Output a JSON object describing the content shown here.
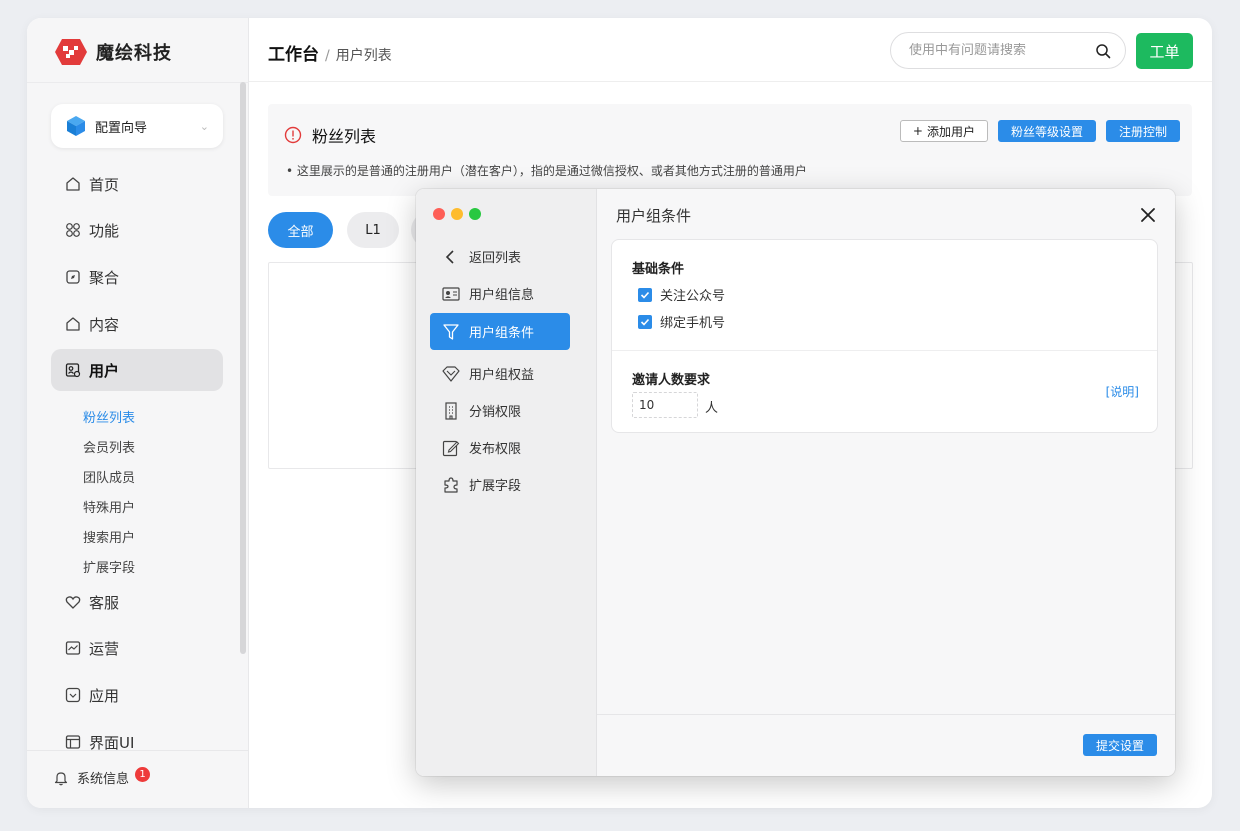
{
  "brand": {
    "name": "魔绘科技"
  },
  "header": {
    "breadcrumb_main": "工作台",
    "breadcrumb_sep": "/",
    "breadcrumb_sub": "用户列表",
    "search_placeholder": "使用中有问题请搜索",
    "ticket_label": "工单"
  },
  "sidebar": {
    "wizard_label": "配置向导",
    "items": [
      {
        "label": "首页",
        "icon": "home-icon"
      },
      {
        "label": "功能",
        "icon": "grid-icon"
      },
      {
        "label": "聚合",
        "icon": "compass-icon"
      },
      {
        "label": "内容",
        "icon": "home-icon"
      },
      {
        "label": "用户",
        "icon": "user-card-icon",
        "active": true
      },
      {
        "label": "客服",
        "icon": "heart-icon"
      },
      {
        "label": "运营",
        "icon": "chart-icon"
      },
      {
        "label": "应用",
        "icon": "app-icon"
      },
      {
        "label": "界面UI",
        "icon": "layout-icon"
      }
    ],
    "sub_items": [
      "粉丝列表",
      "会员列表",
      "团队成员",
      "特殊用户",
      "搜索用户",
      "扩展字段"
    ],
    "system_info_label": "系统信息",
    "system_info_badge": "1"
  },
  "panel": {
    "title": "粉丝列表",
    "add_user_label": "添加用户",
    "level_settings_label": "粉丝等级设置",
    "register_control_label": "注册控制",
    "note": "• 这里展示的是普通的注册用户（潜在客户），指的是通过微信授权、或者其他方式注册的普通用户"
  },
  "filters": {
    "all_label": "全部",
    "l1_label": "L1"
  },
  "modal": {
    "title": "用户组条件",
    "nav": [
      {
        "label": "返回列表",
        "icon": "chevron-left-icon"
      },
      {
        "label": "用户组信息",
        "icon": "id-card-icon"
      },
      {
        "label": "用户组条件",
        "icon": "filter-icon",
        "active": true
      },
      {
        "label": "用户组权益",
        "icon": "diamond-icon"
      },
      {
        "label": "分销权限",
        "icon": "building-icon"
      },
      {
        "label": "发布权限",
        "icon": "edit-icon"
      },
      {
        "label": "扩展字段",
        "icon": "puzzle-icon"
      }
    ],
    "basic_title": "基础条件",
    "basic_options": [
      {
        "label": "关注公众号",
        "checked": true
      },
      {
        "label": "绑定手机号",
        "checked": true
      }
    ],
    "invite_title": "邀请人数要求",
    "invite_value": "10",
    "invite_unit": "人",
    "explain_link": "[说明]",
    "submit_label": "提交设置"
  },
  "colors": {
    "accent_blue": "#2b8ce8",
    "ticket_green": "#1dba5f",
    "badge_red": "#ee3b3b",
    "traffic_red": "#fe5f57",
    "traffic_yellow": "#febc2e",
    "traffic_green": "#28c840"
  }
}
